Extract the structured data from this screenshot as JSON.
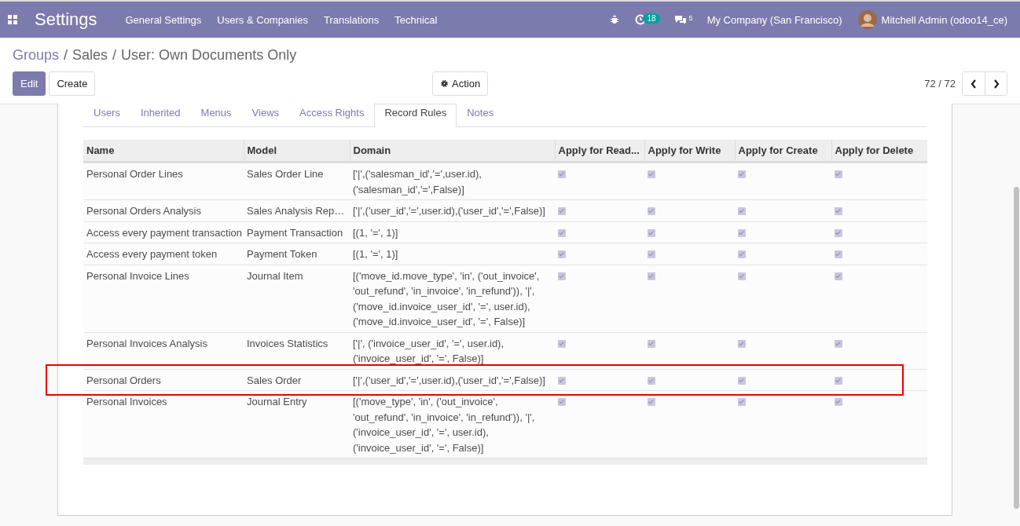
{
  "navbar": {
    "app_title": "Settings",
    "menus": [
      "General Settings",
      "Users & Companies",
      "Translations",
      "Technical"
    ],
    "activity_count": "18",
    "message_count": "5",
    "company": "My Company (San Francisco)",
    "user": "Mitchell Admin (odoo14_ce)"
  },
  "breadcrumb": [
    "Groups",
    "Sales",
    "User: Own Documents Only"
  ],
  "breadcrumb_separator": "/",
  "buttons": {
    "edit": "Edit",
    "create": "Create",
    "action": "Action"
  },
  "pager": "72 / 72",
  "tabs": [
    {
      "label": "Users",
      "selected": false
    },
    {
      "label": "Inherited",
      "selected": false
    },
    {
      "label": "Menus",
      "selected": false
    },
    {
      "label": "Views",
      "selected": false
    },
    {
      "label": "Access Rights",
      "selected": false
    },
    {
      "label": "Record Rules",
      "selected": true
    },
    {
      "label": "Notes",
      "selected": false
    }
  ],
  "table": {
    "columns": [
      "Name",
      "Model",
      "Domain",
      "Apply for Read...",
      "Apply for Write",
      "Apply for Create",
      "Apply for Delete"
    ],
    "rows": [
      {
        "name": "Personal Order Lines",
        "model": "Sales Order Line",
        "domain": "['|',('salesman_id','=',user.id),\n('salesman_id','=',False)]",
        "read": true,
        "write": true,
        "create": true,
        "delete": true,
        "highlighted": false
      },
      {
        "name": "Personal Orders Analysis",
        "model": "Sales Analysis Rep…",
        "domain": "['|',('user_id','=',user.id),('user_id','=',False)]",
        "read": true,
        "write": true,
        "create": true,
        "delete": true,
        "highlighted": false
      },
      {
        "name": "Access every payment transaction",
        "model": "Payment Transaction",
        "domain": "[(1, '=', 1)]",
        "read": true,
        "write": true,
        "create": true,
        "delete": true,
        "highlighted": false
      },
      {
        "name": "Access every payment token",
        "model": "Payment Token",
        "domain": "[(1, '=', 1)]",
        "read": true,
        "write": true,
        "create": true,
        "delete": true,
        "highlighted": false
      },
      {
        "name": "Personal Invoice Lines",
        "model": "Journal Item",
        "domain": "[('move_id.move_type', 'in', ('out_invoice',\n'out_refund', 'in_invoice', 'in_refund')), '|',\n('move_id.invoice_user_id', '=', user.id),\n('move_id.invoice_user_id', '=', False)]",
        "read": true,
        "write": true,
        "create": true,
        "delete": true,
        "highlighted": false
      },
      {
        "name": "Personal Invoices Analysis",
        "model": "Invoices Statistics",
        "domain": "['|', ('invoice_user_id', '=', user.id),\n('invoice_user_id', '=', False)]",
        "read": true,
        "write": true,
        "create": true,
        "delete": true,
        "highlighted": false
      },
      {
        "name": "Personal Orders",
        "model": "Sales Order",
        "domain": "['|',('user_id','=',user.id),('user_id','=',False)]",
        "read": true,
        "write": true,
        "create": true,
        "delete": true,
        "highlighted": true
      },
      {
        "name": "Personal Invoices",
        "model": "Journal Entry",
        "domain": "[('move_type', 'in', ('out_invoice',\n'out_refund', 'in_invoice', 'in_refund')), '|',\n('invoice_user_id', '=', user.id),\n('invoice_user_id', '=', False)]",
        "read": true,
        "write": true,
        "create": true,
        "delete": true,
        "highlighted": false
      }
    ]
  }
}
